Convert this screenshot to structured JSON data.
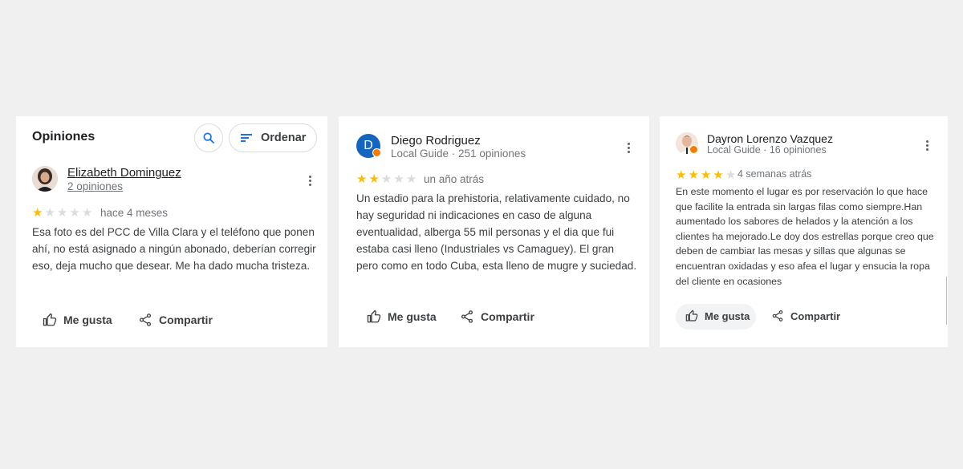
{
  "panel": {
    "title": "Opiniones",
    "search_icon": "search-icon",
    "sort_label": "Ordenar",
    "sort_icon": "sort-lines-icon",
    "accent_color": "#1a73e8"
  },
  "reviews": [
    {
      "author": "Elizabeth Dominguez",
      "meta": "2 opiniones",
      "rating": 1,
      "date": "hace 4 meses",
      "text": "Esa foto es del PCC de Villa Clara y el teléfono que ponen ahí, no está asignado a ningún abonado, deberían corregir eso, deja mucho que desear. Me ha dado mucha tristeza.",
      "like_label": "Me gusta",
      "share_label": "Compartir"
    },
    {
      "author": "Diego Rodriguez",
      "avatar_letter": "D",
      "avatar_color": "#1565c0",
      "meta": "Local Guide · 251 opiniones",
      "rating": 2,
      "date": "un año atrás",
      "text": "Un estadio para la prehistoria, relativamente cuidado, no hay seguridad ni indicaciones en caso de alguna eventualidad, alberga 55 mil personas y el dia que fui estaba casi lleno (Industriales vs Camaguey). El gran pero como en todo Cuba, esta lleno de mugre y suciedad.",
      "like_label": "Me gusta",
      "share_label": "Compartir"
    },
    {
      "author": "Dayron Lorenzo Vazquez",
      "meta": "Local Guide · 16 opiniones",
      "rating": 4,
      "date": "4 semanas atrás",
      "text": "En este momento el lugar es por reservación lo que hace que facilite la entrada sin largas filas como siempre.Han aumentado los sabores de helados y la atención a los clientes ha mejorado.Le doy dos estrellas porque creo que deben de cambiar las mesas y sillas que algunas se encuentran oxidadas y eso afea el lugar y ensucia la ropa del cliente en ocasiones",
      "like_label": "Me gusta",
      "share_label": "Compartir"
    }
  ],
  "colors": {
    "star_on": "#fbbc04",
    "star_off": "#dadce0",
    "local_guide_badge": "#f57c00"
  }
}
